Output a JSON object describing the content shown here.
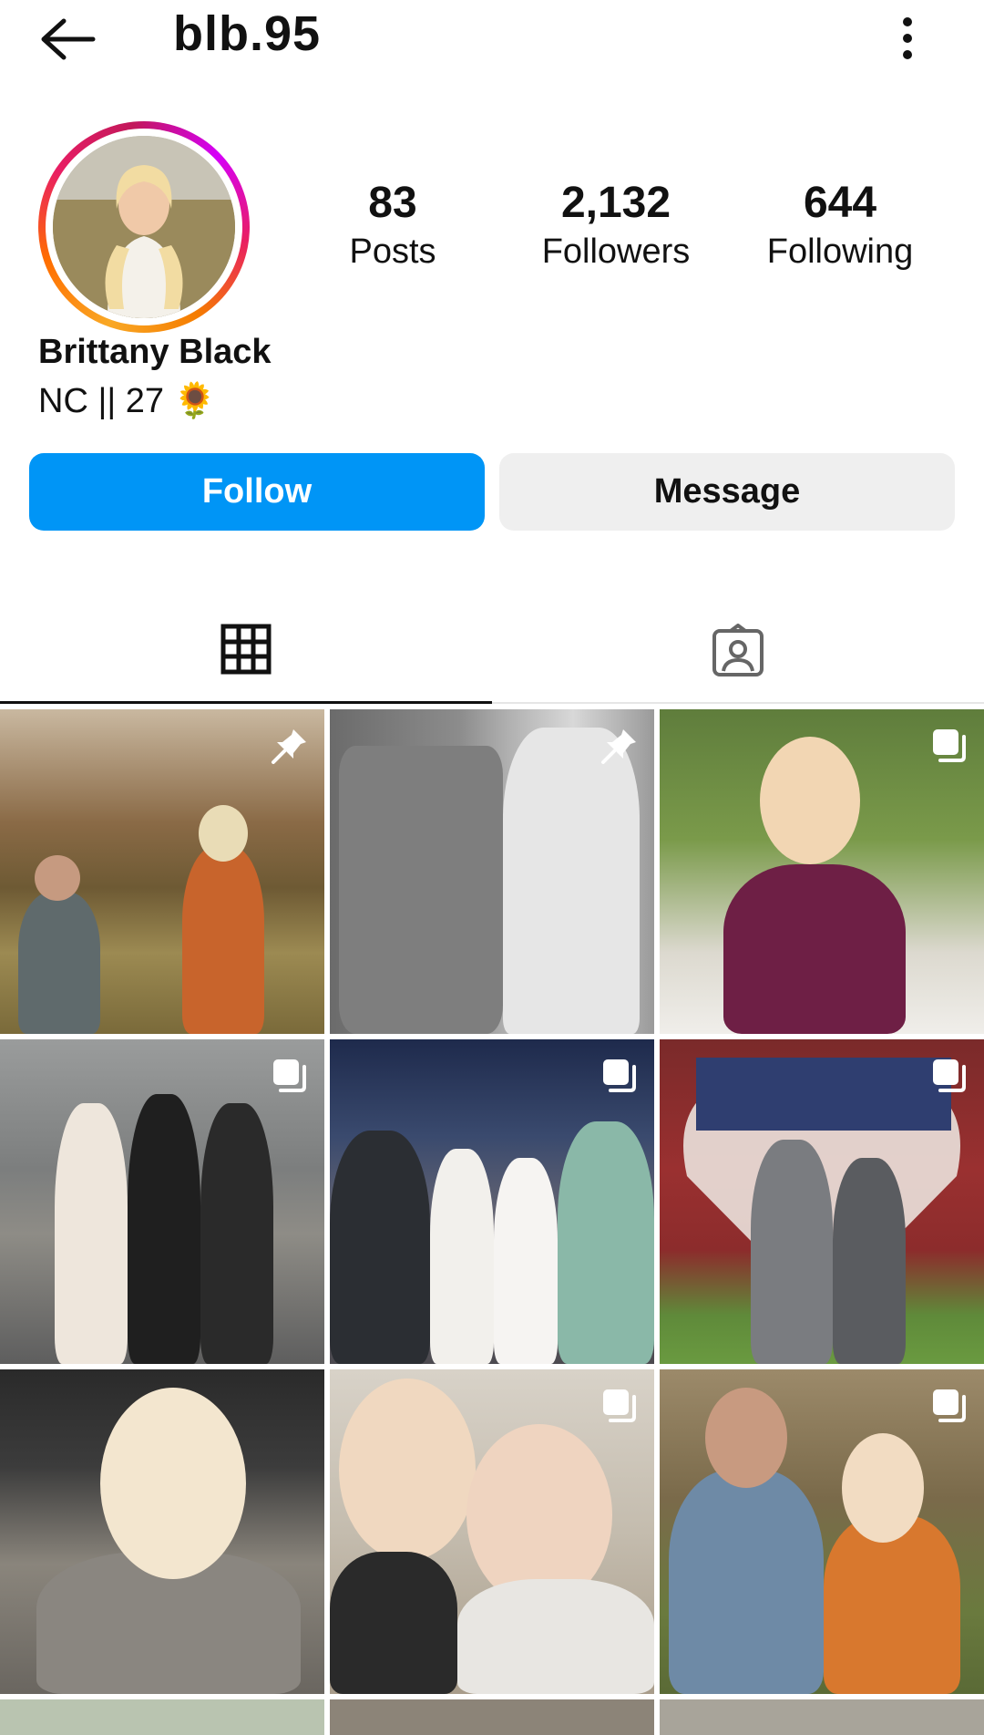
{
  "header": {
    "username": "blb.95"
  },
  "profile": {
    "full_name": "Brittany Black",
    "bio_text": "NC || 27",
    "bio_emoji": "🌻"
  },
  "stats": {
    "posts": {
      "value": "83",
      "label": "Posts"
    },
    "followers": {
      "value": "2,132",
      "label": "Followers"
    },
    "following": {
      "value": "644",
      "label": "Following"
    }
  },
  "actions": {
    "follow_label": "Follow",
    "message_label": "Message"
  },
  "tabs": [
    {
      "icon": "grid-icon",
      "active": true
    },
    {
      "icon": "tagged-icon",
      "active": false
    }
  ],
  "posts": [
    {
      "description": "proposal in field",
      "badge": "pin-icon"
    },
    {
      "description": "black and white couple",
      "badge": "pin-icon"
    },
    {
      "description": "woman holding chocolate strawberry",
      "badge": "multi-photo-icon"
    },
    {
      "description": "three women at concert",
      "badge": "multi-photo-icon"
    },
    {
      "description": "group at concert",
      "badge": "multi-photo-icon"
    },
    {
      "description": "couple at flag heart barn",
      "badge": "multi-photo-icon"
    },
    {
      "description": "selfie in car",
      "badge": "none"
    },
    {
      "description": "selfie with friend in cap",
      "badge": "multi-photo-icon"
    },
    {
      "description": "couple outdoors",
      "badge": "multi-photo-icon"
    }
  ],
  "colors": {
    "follow_blue": "#0095f6",
    "message_gray": "#efefef"
  }
}
